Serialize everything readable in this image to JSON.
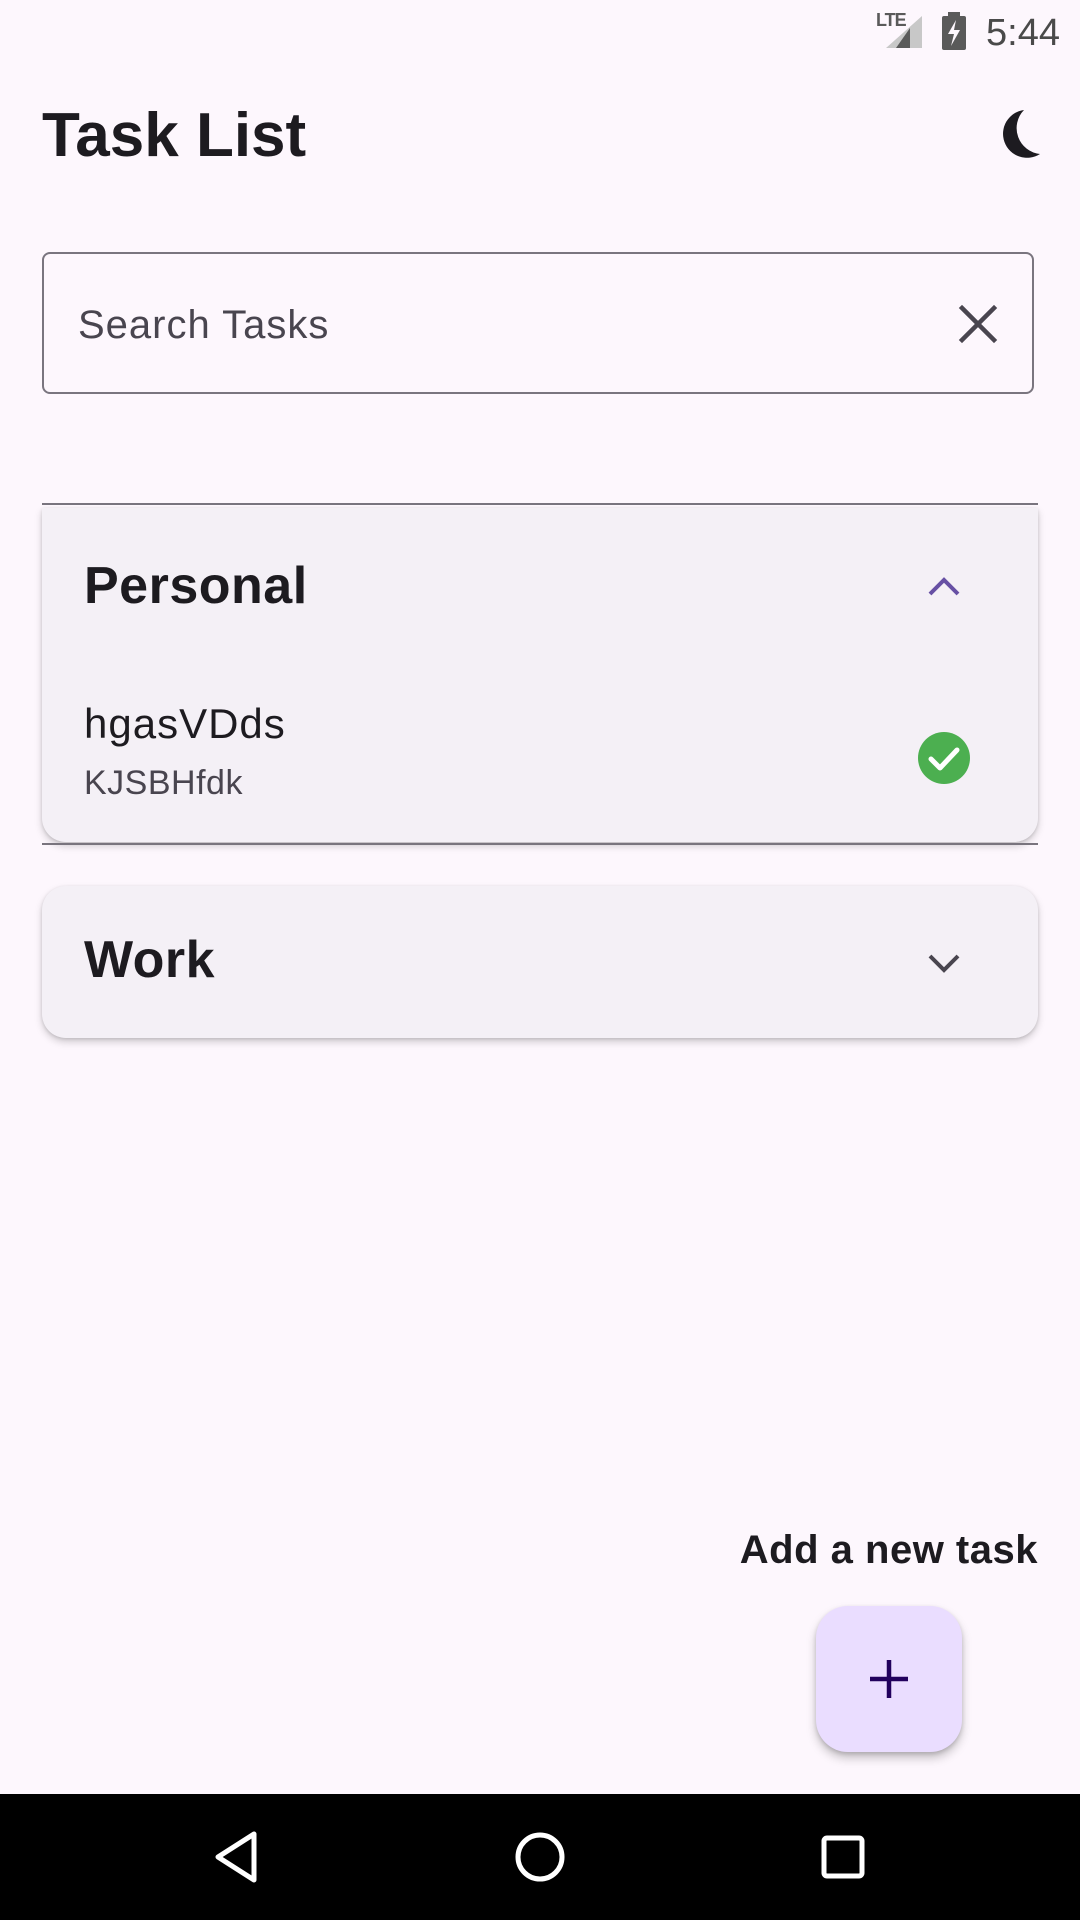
{
  "status_bar": {
    "network": "LTE",
    "time": "5:44"
  },
  "app_bar": {
    "title": "Task List",
    "theme_toggle_icon": "moon-icon"
  },
  "search": {
    "placeholder": "Search Tasks",
    "value": "",
    "clear_icon": "close-icon"
  },
  "categories": [
    {
      "name": "Personal",
      "expanded": true,
      "chevron_icon": "chevron-up-icon",
      "tasks": [
        {
          "title": "hgasVDds",
          "description": "KJSBHfdk",
          "completed": true,
          "status_icon": "check-circle-icon"
        }
      ]
    },
    {
      "name": "Work",
      "expanded": false,
      "chevron_icon": "chevron-down-icon",
      "tasks": []
    }
  ],
  "fab": {
    "label": "Add a new task",
    "icon": "plus-icon"
  },
  "nav": {
    "back_icon": "back-triangle-icon",
    "home_icon": "home-circle-icon",
    "recents_icon": "recents-square-icon"
  },
  "colors": {
    "background": "#fdf7fd",
    "card": "#f4f0f6",
    "accent": "#6750a4",
    "fab": "#eaddff",
    "check": "#4caf50"
  }
}
